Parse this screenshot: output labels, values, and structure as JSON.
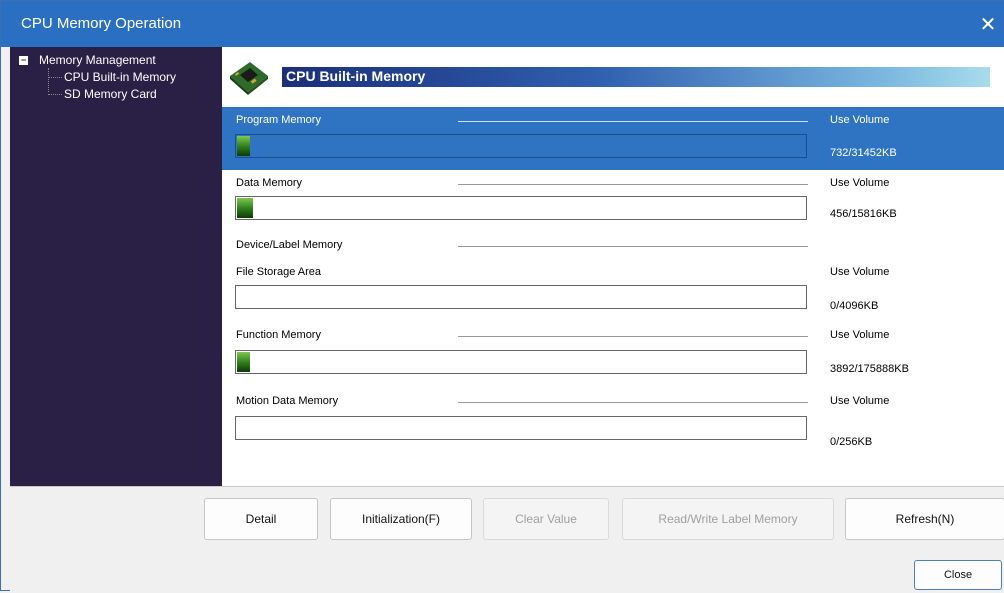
{
  "window": {
    "title": "CPU Memory Operation",
    "close_glyph": "✕"
  },
  "tree": {
    "root": {
      "label": "Memory Management",
      "toggle": "−"
    },
    "children": [
      {
        "label": "CPU Built-in Memory"
      },
      {
        "label": "SD Memory Card"
      }
    ]
  },
  "header": {
    "title": "CPU Built-in Memory",
    "icon": "cpu-chip-icon"
  },
  "sections": {
    "program": {
      "label": "Program Memory",
      "use_label": "Use Volume",
      "value": "732/31452KB",
      "usage_fraction": 0.0233
    },
    "data": {
      "label": "Data Memory",
      "use_label": "Use Volume",
      "value": "456/15816KB",
      "usage_fraction": 0.0288
    },
    "device": {
      "label": "Device/Label Memory"
    },
    "file": {
      "label": "File Storage Area",
      "use_label": "Use Volume",
      "value": "0/4096KB",
      "usage_fraction": 0
    },
    "function": {
      "label": "Function Memory",
      "use_label": "Use Volume",
      "value": "3892/175888KB",
      "usage_fraction": 0.0221
    },
    "motion": {
      "label": "Motion Data Memory",
      "use_label": "Use Volume",
      "value": "0/256KB",
      "usage_fraction": 0
    }
  },
  "buttons": {
    "detail": "Detail",
    "initialization": "Initialization(F)",
    "clear_value": "Clear Value",
    "read_write_label": "Read/Write Label Memory",
    "refresh": "Refresh(N)",
    "close": "Close"
  },
  "colors": {
    "titlebar": "#2b6fc2",
    "sidebar": "#2a1f44",
    "selected_row": "#2f74c2",
    "bar_fill": "#2c7a1a"
  }
}
